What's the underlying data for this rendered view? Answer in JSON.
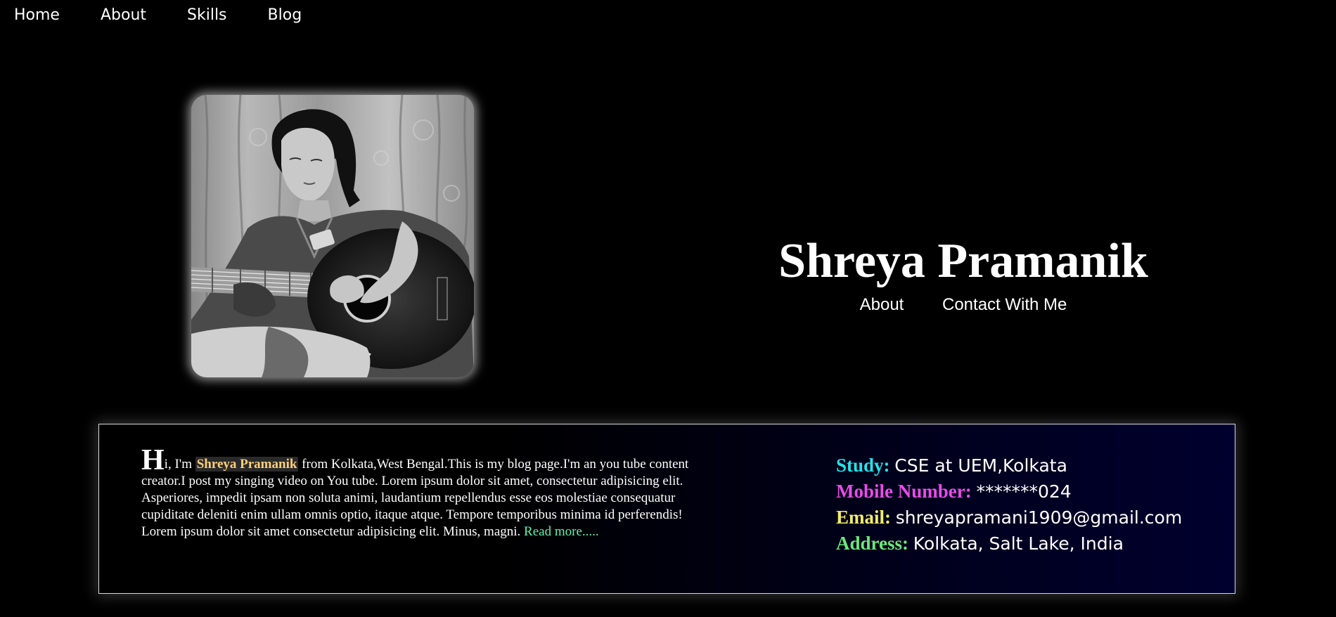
{
  "nav": {
    "items": [
      {
        "label": "Home"
      },
      {
        "label": "About"
      },
      {
        "label": "Skills"
      },
      {
        "label": "Blog"
      }
    ]
  },
  "hero": {
    "name": "Shreya Pramanik",
    "links": [
      {
        "label": "About"
      },
      {
        "label": "Contact With Me"
      }
    ]
  },
  "bio": {
    "dropcap": "H",
    "intro": "i, I'm ",
    "name": "Shreya Pramanik",
    "text": " from Kolkata,West Bengal.This is my blog page.I'm an you tube content creator.I post my singing video on You tube. Lorem ipsum dolor sit amet, consectetur adipisicing elit. Asperiores, impedit ipsam non soluta animi, laudantium repellendus esse eos molestiae consequatur cupiditate deleniti enim ullam omnis optio, itaque atque. Tempore temporibus minima id perferendis! Lorem ipsum dolor sit amet consectetur adipisicing elit. Minus, magni. ",
    "read_more": "Read more....."
  },
  "contact": [
    {
      "key": "Study:",
      "value": "CSE at UEM,Kolkata",
      "color": "#22e3ea"
    },
    {
      "key": "Mobile Number:",
      "value": "*******024",
      "color": "#e84ce8"
    },
    {
      "key": "Email:",
      "value": "shreyapramani1909@gmail.com",
      "color": "#f2ec6a"
    },
    {
      "key": "Address:",
      "value": "Kolkata, Salt Lake, India",
      "color": "#6de67a"
    }
  ],
  "colors": {
    "background": "#000000",
    "highlight_name": "#ffcf7a",
    "read_more": "#5ff2b0"
  }
}
